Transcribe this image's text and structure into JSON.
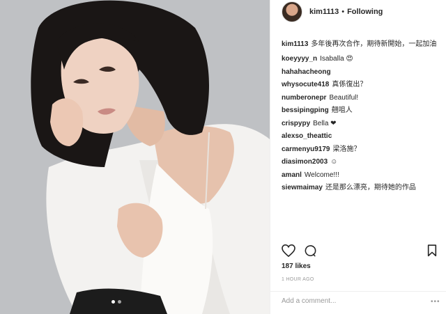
{
  "header": {
    "username": "kim1113",
    "separator": "•",
    "follow_status": "Following"
  },
  "comments": [
    {
      "user": "kim1113",
      "text": "多年後再次合作，期待新開始，一起加油"
    },
    {
      "user": "koeyyyy_n",
      "text": "Isaballa 😍"
    },
    {
      "user": "hahahacheong",
      "text": ""
    },
    {
      "user": "whysocute418",
      "text": "真係復出？"
    },
    {
      "user": "numberonepr",
      "text": "Beautiful!"
    },
    {
      "user": "bessipingping",
      "text": "翹咀人"
    },
    {
      "user": "crispypy",
      "text": "Bella ❤"
    },
    {
      "user": "alexso_theattic",
      "text": ""
    },
    {
      "user": "carmenyu9179",
      "text": "梁洛施？"
    },
    {
      "user": "diasimon2003",
      "text": "☺"
    },
    {
      "user": "amanl",
      "text": "Welcome!!!"
    },
    {
      "user": "siewmaimay",
      "text": "还是那么漂亮，期待她的作品"
    }
  ],
  "likes": "187 likes",
  "timestamp": "1 HOUR AGO",
  "add_comment_placeholder": "Add a comment...",
  "more_options": "•••",
  "icons": [
    "heart-icon",
    "comment-icon",
    "bookmark-icon"
  ]
}
